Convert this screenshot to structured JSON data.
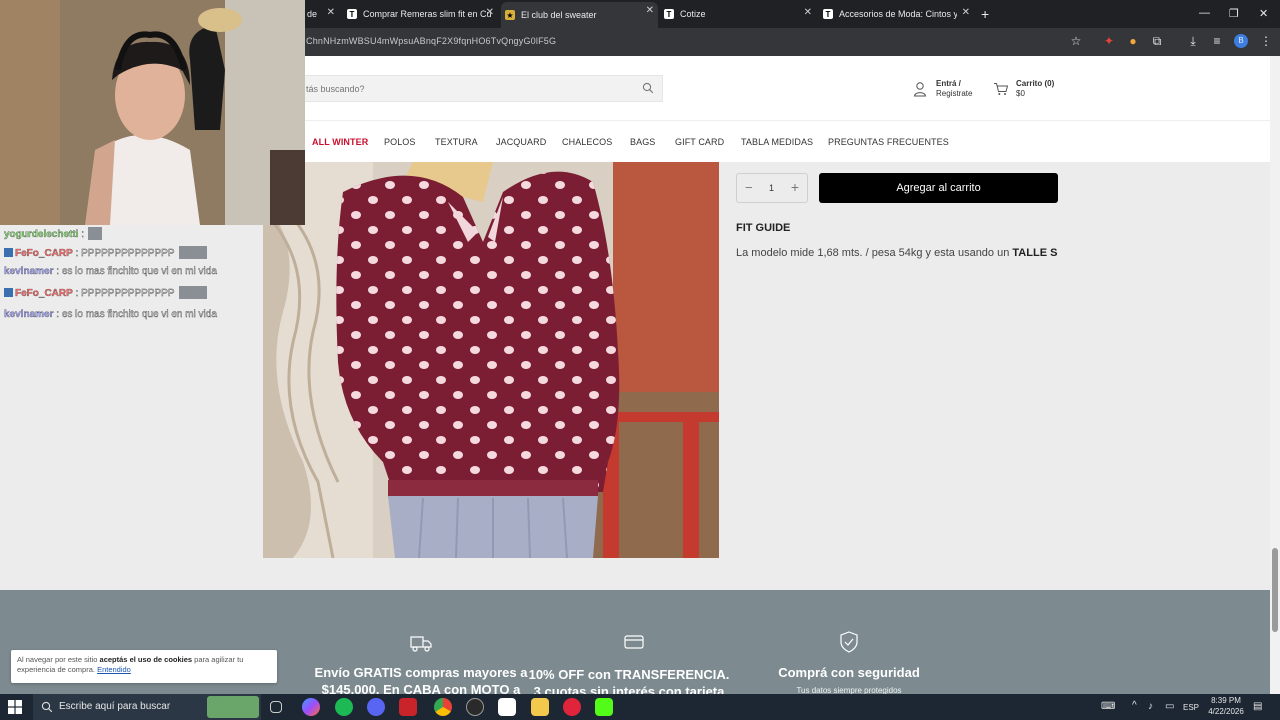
{
  "tabs": [
    {
      "label": "de",
      "fav": ""
    },
    {
      "label": "Comprar Remeras slim fit en Cu",
      "fav": "T"
    },
    {
      "label": "El club del sweater",
      "fav": "★",
      "active": true
    },
    {
      "label": "Cotize",
      "fav": "T"
    },
    {
      "label": "Accesorios de Moda: Cintos y C",
      "fav": "T"
    }
  ],
  "browser": {
    "url": "ChnNHzmWBSU4mWpsuABnqF2X9fqnHO6TvQngyG0lF5G",
    "profile_initial": "B"
  },
  "header": {
    "search_placeholder": "tás buscando?",
    "account_line1": "Entrá /",
    "account_line2": "Registrate",
    "cart_line1": "Carrito (0)",
    "cart_line2": "$0"
  },
  "nav": [
    {
      "label": "ALL WINTER",
      "active": true
    },
    {
      "label": "POLOS"
    },
    {
      "label": "TEXTURA"
    },
    {
      "label": "JACQUARD"
    },
    {
      "label": "CHALECOS"
    },
    {
      "label": "BAGS"
    },
    {
      "label": "GIFT CARD"
    },
    {
      "label": "TABLA MEDIDAS"
    },
    {
      "label": "PREGUNTAS FRECUENTES"
    }
  ],
  "product": {
    "quantity": "1",
    "add_to_cart": "Agregar al carrito",
    "fit_guide_title": "FIT GUIDE",
    "fit_desc_prefix": "La modelo mide 1,68 mts. / pesa 54kg y esta usando un ",
    "fit_desc_size": "TALLE S"
  },
  "footer": {
    "shipping_title_1": "Envío GRATIS compras mayores a",
    "shipping_title_2": "$145.000. En CABA con MOTO a",
    "discount_title_1": "10% OFF con TRANSFERENCIA.",
    "discount_title_2": "3 cuotas sin interés con tarjeta",
    "secure_title": "Comprá con seguridad",
    "secure_sub": "Tus datos siempre protegidos"
  },
  "cookie": {
    "text_prefix": "Al navegar por este sitio ",
    "text_bold": "aceptás el uso de cookies",
    "text_suffix": " para agilizar tu experiencia de compra.",
    "accept": "Entendido"
  },
  "chat": [
    {
      "user": "yogurdelechetti",
      "msg": " :",
      "emote": true
    },
    {
      "user": "FeFo_CARP",
      "msg": " : PPPPPPPPPPPPPP",
      "badge": true,
      "emote": true
    },
    {
      "user": "kevlnamer",
      "msg": " : es lo mas finchito que vi en mi vida"
    },
    {
      "user": "FeFo_CARP",
      "msg": " : PPPPPPPPPPPPPP",
      "badge": true,
      "emote": true
    },
    {
      "user": "kevlnamer",
      "msg": " : es lo mas finchito que vi en mi vida"
    }
  ],
  "taskbar": {
    "search_label": "Escribe aquí para buscar",
    "lang": "ESP",
    "time": "8:39 PM",
    "date": "4/22/2026"
  },
  "colors": {
    "accent_red": "#c8102e",
    "footer_bg": "#7d8b90",
    "sweater": "#7b1e34"
  }
}
